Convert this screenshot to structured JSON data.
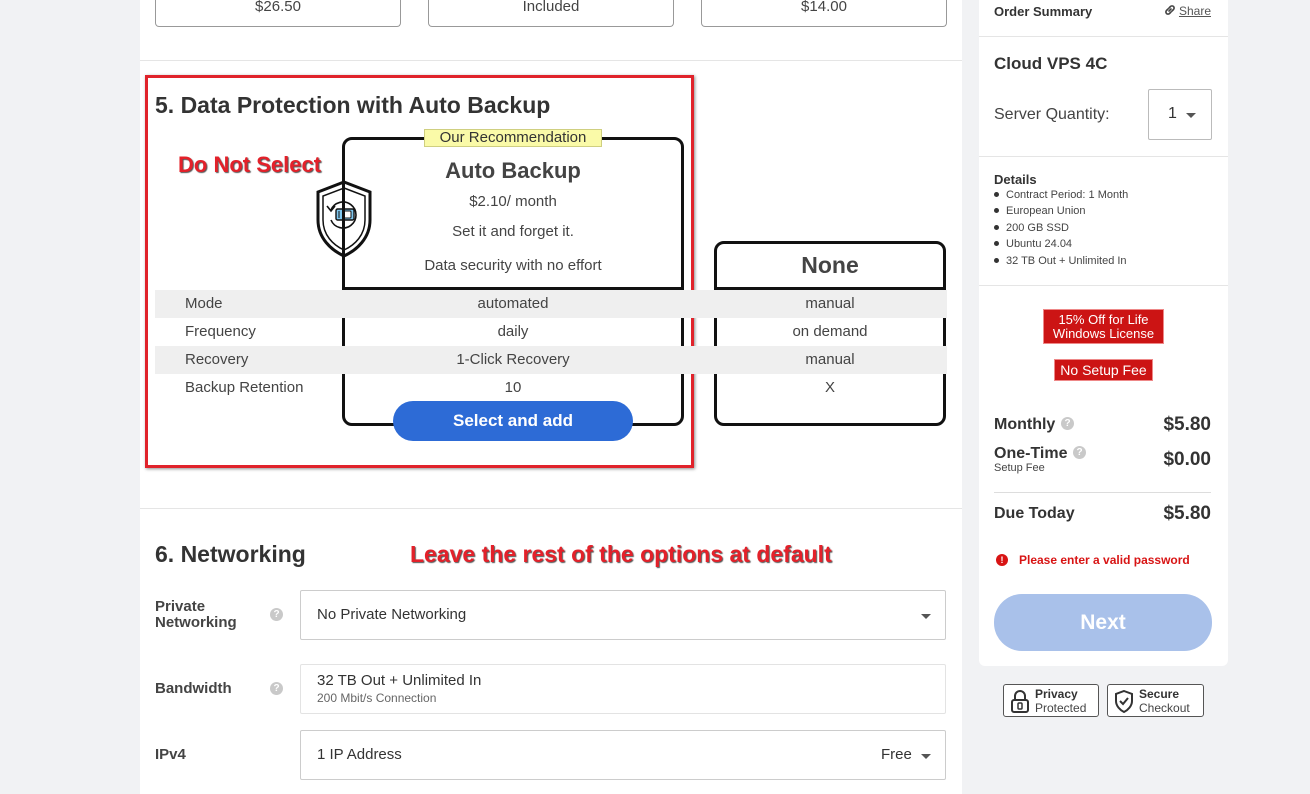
{
  "top_prices": [
    "$26.50",
    "Included",
    "$14.00"
  ],
  "backup": {
    "title": "5. Data Protection with Auto Backup",
    "annotation": "Do Not Select",
    "recommendation": "Our Recommendation",
    "option_name": "Auto Backup",
    "price": "$2.10/ month",
    "tagline": "Set it and forget it.",
    "subtagline": "Data security with no effort",
    "none_label": "None",
    "rows": [
      {
        "label": "Mode",
        "auto": "automated",
        "none": "manual"
      },
      {
        "label": "Frequency",
        "auto": "daily",
        "none": "on demand"
      },
      {
        "label": "Recovery",
        "auto": "1-Click Recovery",
        "none": "manual"
      },
      {
        "label": "Backup Retention",
        "auto": "10",
        "none": "X"
      }
    ],
    "select_button": "Select and add"
  },
  "networking": {
    "title": "6. Networking",
    "annotation": "Leave the rest of the options at default",
    "help_glyph": "?",
    "private": {
      "label": "Private Networking",
      "value": "No Private Networking"
    },
    "bandwidth": {
      "label": "Bandwidth",
      "value": "32 TB Out + Unlimited In",
      "sub": "200 Mbit/s Connection"
    },
    "ipv4": {
      "label": "IPv4",
      "value": "1 IP Address",
      "price": "Free"
    }
  },
  "summary": {
    "header": "Order Summary",
    "share": "Share",
    "product": "Cloud VPS 4C",
    "quantity_label": "Server Quantity:",
    "quantity_value": "1",
    "details_title": "Details",
    "details": [
      "Contract Period: 1 Month",
      "European Union",
      "200 GB SSD",
      "Ubuntu 24.04",
      "32 TB Out + Unlimited In"
    ],
    "promo_windows": "15% Off for Life Windows License",
    "promo_setup": "No Setup Fee",
    "monthly_label": "Monthly",
    "monthly_value": "$5.80",
    "onetime_label": "One-Time",
    "onetime_sub": "Setup Fee",
    "onetime_value": "$0.00",
    "due_label": "Due Today",
    "due_value": "$5.80",
    "error": "Please enter a valid password",
    "next_button": "Next",
    "trust": [
      {
        "title": "Privacy",
        "sub": "Protected"
      },
      {
        "title": "Secure",
        "sub": "Checkout"
      }
    ]
  },
  "colors": {
    "accent_blue": "#2d6bd6",
    "annotation_red": "#e3212a",
    "promo_red": "#cc1414",
    "next_disabled": "#a9c1ea"
  }
}
